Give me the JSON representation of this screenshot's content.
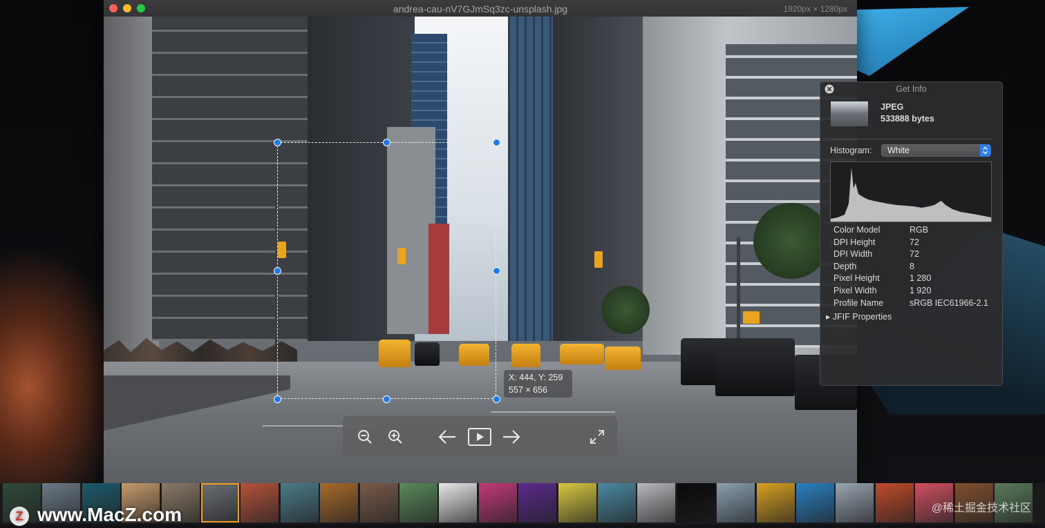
{
  "window": {
    "title": "andrea-cau-nV7GJmSq3zc-unsplash.jpg",
    "dimensions": "1920px × 1280px"
  },
  "selection": {
    "coords": "X: 444, Y: 259",
    "size": "557 × 656"
  },
  "toolbar": {
    "buttons": [
      "zoom-out-icon",
      "zoom-in-icon",
      "arrow-left-icon",
      "play-icon",
      "arrow-right-icon",
      "fullscreen-icon"
    ]
  },
  "info": {
    "title": "Get Info",
    "format": "JPEG",
    "bytes": "533888 bytes",
    "histogram_label": "Histogram:",
    "histogram_value": "White",
    "properties": [
      {
        "key": "Color Model",
        "value": "RGB"
      },
      {
        "key": "DPI Height",
        "value": "72"
      },
      {
        "key": "DPI Width",
        "value": "72"
      },
      {
        "key": "Depth",
        "value": "8"
      },
      {
        "key": "Pixel Height",
        "value": "1 280"
      },
      {
        "key": "Pixel Width",
        "value": "1 920"
      },
      {
        "key": "Profile Name",
        "value": "sRGB IEC61966-2.1"
      }
    ],
    "jfif": "JFIF Properties"
  },
  "filmstrip": {
    "selected_index": 5,
    "thumbnail_colors": [
      "#2f4a3a",
      "#6c7a86",
      "#1c5a6a",
      "#c59a6a",
      "#8a7a66",
      "#6a6e73",
      "#b5533a",
      "#4c7c8a",
      "#a86a2a",
      "#7a5a48",
      "#5a8a5a",
      "#e8e8e8",
      "#c23a78",
      "#5a2a8a",
      "#d8c840",
      "#4a8aa0",
      "#b8b8bc",
      "#0a0a0c",
      "#8aa0b0",
      "#d8a020",
      "#2a80c0",
      "#9aa4b0",
      "#c04a2a",
      "#d05060",
      "#805030",
      "#5a7a5a"
    ],
    "color_theme": {
      "accent": "#1a7cf0",
      "selection_border": "#f0a020",
      "window_bg": "#2a2a2c"
    }
  },
  "watermarks": {
    "left_badge": "Z",
    "left_text": "www.MacZ.com",
    "right_text": "@稀土掘金技术社区"
  }
}
